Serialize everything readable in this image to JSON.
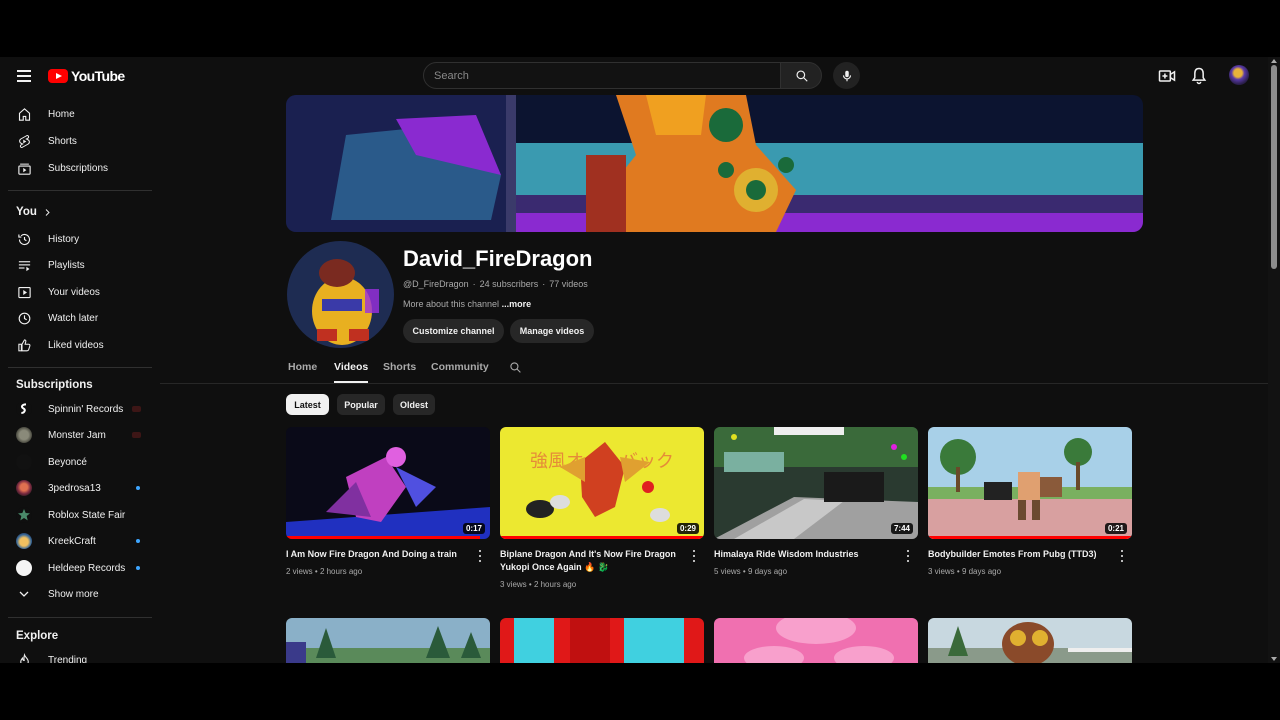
{
  "header": {
    "logo_text": "YouTube",
    "search_placeholder": "Search"
  },
  "sidebar": {
    "main": [
      {
        "label": "Home",
        "icon": "home-icon"
      },
      {
        "label": "Shorts",
        "icon": "shorts-icon"
      },
      {
        "label": "Subscriptions",
        "icon": "subscriptions-icon"
      }
    ],
    "you_title": "You",
    "you": [
      {
        "label": "History",
        "icon": "history-icon"
      },
      {
        "label": "Playlists",
        "icon": "playlists-icon"
      },
      {
        "label": "Your videos",
        "icon": "your-videos-icon"
      },
      {
        "label": "Watch later",
        "icon": "watch-later-icon"
      },
      {
        "label": "Liked videos",
        "icon": "liked-videos-icon"
      }
    ],
    "subscriptions_title": "Subscriptions",
    "subscriptions": [
      {
        "label": "Spinnin' Records",
        "indicator": "live"
      },
      {
        "label": "Monster Jam",
        "indicator": "live"
      },
      {
        "label": "Beyoncé",
        "indicator": "none"
      },
      {
        "label": "3pedrosa13",
        "indicator": "new"
      },
      {
        "label": "Roblox State Fair",
        "indicator": "none"
      },
      {
        "label": "KreekCraft",
        "indicator": "new"
      },
      {
        "label": "Heldeep Records",
        "indicator": "new"
      }
    ],
    "show_more": "Show more",
    "explore_title": "Explore",
    "explore": [
      {
        "label": "Trending",
        "icon": "trending-icon"
      }
    ]
  },
  "channel": {
    "name": "David_FireDragon",
    "handle": "@D_FireDragon",
    "subscribers": "24 subscribers",
    "videos_count": "77 videos",
    "about": "More about this channel",
    "about_more": "...more",
    "customize_label": "Customize channel",
    "manage_label": "Manage videos"
  },
  "tabs": [
    "Home",
    "Videos",
    "Shorts",
    "Community"
  ],
  "active_tab": "Videos",
  "chips": [
    "Latest",
    "Popular",
    "Oldest"
  ],
  "active_chip": "Latest",
  "videos": [
    {
      "title": "I Am Now Fire Dragon And Doing a train",
      "views": "2 views",
      "age": "2 hours ago",
      "duration": "0:17",
      "watched": 0.95
    },
    {
      "title": "Biplane Dragon And It's Now Fire Dragon Yukopi Once Again 🔥 🐉",
      "views": "3 views",
      "age": "2 hours ago",
      "duration": "0:29",
      "watched": 1.0
    },
    {
      "title": "Himalaya Ride Wisdom Industries",
      "views": "5 views",
      "age": "9 days ago",
      "duration": "7:44",
      "watched": 0.0
    },
    {
      "title": "Bodybuilder Emotes From Pubg (TTD3)",
      "views": "3 views",
      "age": "9 days ago",
      "duration": "0:21",
      "watched": 1.0
    }
  ],
  "colors": {
    "background": "#0f0f0f",
    "brand_red": "#ff0000",
    "text_primary": "#f1f1f1",
    "text_secondary": "#aaaaaa",
    "chip_bg": "#272727"
  }
}
